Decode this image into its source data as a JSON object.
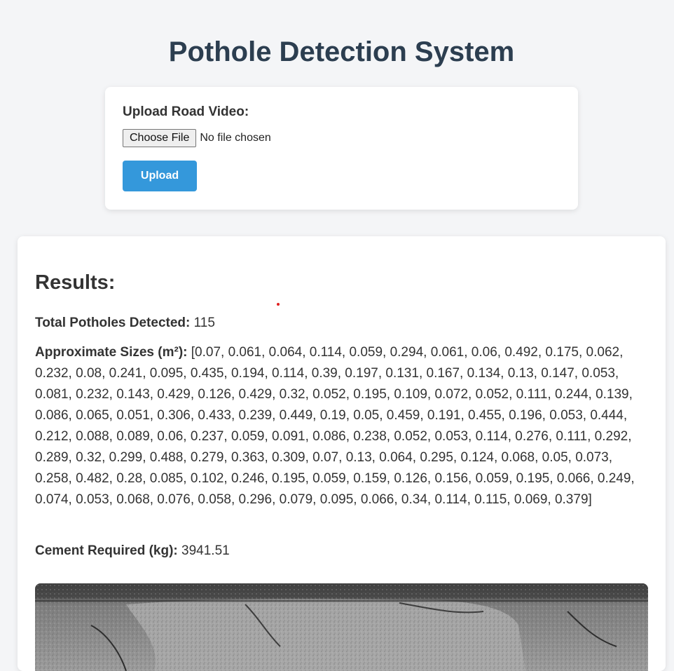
{
  "header": {
    "title": "Pothole Detection System"
  },
  "upload": {
    "label": "Upload Road Video:",
    "choose_file_label": "Choose File",
    "file_status": "No file chosen",
    "upload_button_label": "Upload"
  },
  "results": {
    "heading": "Results:",
    "total_label": "Total Potholes Detected:",
    "total_value": "115",
    "sizes_label": "Approximate Sizes (m²):",
    "sizes_value": "[0.07, 0.061, 0.064, 0.114, 0.059, 0.294, 0.061, 0.06, 0.492, 0.175, 0.062, 0.232, 0.08, 0.241, 0.095, 0.435, 0.194, 0.114, 0.39, 0.197, 0.131, 0.167, 0.134, 0.13, 0.147, 0.053, 0.081, 0.232, 0.143, 0.429, 0.126, 0.429, 0.32, 0.052, 0.195, 0.109, 0.072, 0.052, 0.111, 0.244, 0.139, 0.086, 0.065, 0.051, 0.306, 0.433, 0.239, 0.449, 0.19, 0.05, 0.459, 0.191, 0.455, 0.196, 0.053, 0.444, 0.212, 0.088, 0.089, 0.06, 0.237, 0.059, 0.091, 0.086, 0.238, 0.052, 0.053, 0.114, 0.276, 0.111, 0.292, 0.289, 0.32, 0.299, 0.488, 0.279, 0.363, 0.309, 0.07, 0.13, 0.064, 0.295, 0.124, 0.068, 0.05, 0.073, 0.258, 0.482, 0.28, 0.085, 0.102, 0.246, 0.195, 0.059, 0.159, 0.126, 0.156, 0.059, 0.195, 0.066, 0.249, 0.074, 0.053, 0.068, 0.076, 0.058, 0.296, 0.079, 0.095, 0.066, 0.34, 0.114, 0.115, 0.069, 0.379]",
    "cement_label": "Cement Required (kg):",
    "cement_value": "3941.51"
  },
  "colors": {
    "title": "#2c3e50",
    "accent": "#3498db",
    "background": "#f4f5f7",
    "card": "#ffffff"
  }
}
